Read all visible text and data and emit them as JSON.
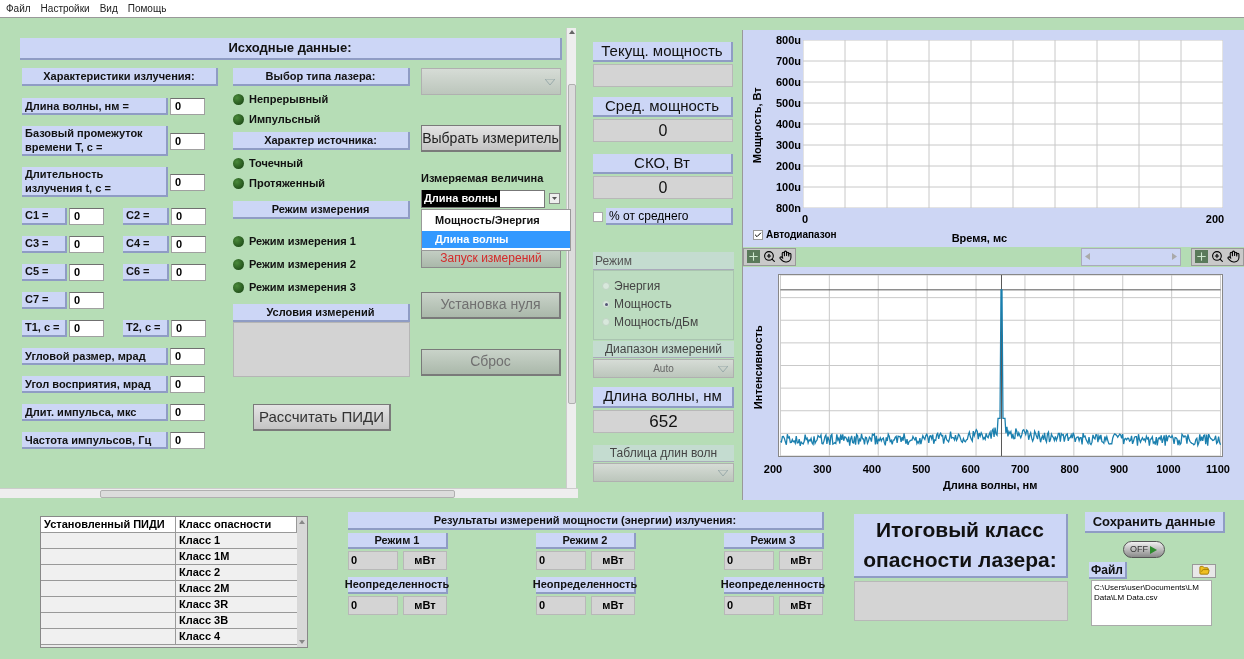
{
  "menu": [
    "Файл",
    "Настройки",
    "Вид",
    "Помощь"
  ],
  "input_panel": {
    "title": "Исходные данные:",
    "radiation": {
      "header": "Характеристики излучения:",
      "rows": [
        {
          "kind": "single",
          "fields": [
            {
              "label": "Длина волны, нм =",
              "value": "0"
            }
          ]
        },
        {
          "kind": "single",
          "fields": [
            {
              "label": "Базовый промежуток времени T, с =",
              "value": "0"
            }
          ]
        },
        {
          "kind": "single",
          "fields": [
            {
              "label": "Длительность излучения t, с =",
              "value": "0"
            }
          ]
        },
        {
          "kind": "pair",
          "fields": [
            {
              "label": "C1 =",
              "value": "0"
            },
            {
              "label": "C2 =",
              "value": "0"
            }
          ]
        },
        {
          "kind": "pair",
          "fields": [
            {
              "label": "C3 =",
              "value": "0"
            },
            {
              "label": "C4 =",
              "value": "0"
            }
          ]
        },
        {
          "kind": "pair",
          "fields": [
            {
              "label": "C5 =",
              "value": "0"
            },
            {
              "label": "C6 =",
              "value": "0"
            }
          ]
        },
        {
          "kind": "pair",
          "fields": [
            {
              "label": "C7 =",
              "value": "0"
            }
          ]
        },
        {
          "kind": "pair",
          "fields": [
            {
              "label": "T1, c =",
              "value": "0"
            },
            {
              "label": "T2, c =",
              "value": "0"
            }
          ]
        },
        {
          "kind": "single",
          "fields": [
            {
              "label": "Угловой размер, мрад",
              "value": "0"
            }
          ]
        },
        {
          "kind": "single",
          "fields": [
            {
              "label": "Угол восприятия, мрад",
              "value": "0"
            }
          ]
        },
        {
          "kind": "single",
          "fields": [
            {
              "label": "Длит. импульса, мкс",
              "value": "0"
            }
          ]
        },
        {
          "kind": "single",
          "fields": [
            {
              "label": "Частота импульсов, Гц",
              "value": "0"
            }
          ]
        }
      ]
    },
    "laser_type": {
      "header": "Выбор типа лазера:",
      "options": [
        {
          "label": "Непрерывный",
          "on": false
        },
        {
          "label": "Импульсный",
          "on": false
        }
      ]
    },
    "source_type": {
      "header": "Характер источника:",
      "options": [
        {
          "label": "Точечный",
          "on": false
        },
        {
          "label": "Протяженный",
          "on": false
        }
      ]
    },
    "measurement_mode": {
      "header": "Режим измерения",
      "options": [
        {
          "label": "Режим измерения 1",
          "on": false
        },
        {
          "label": "Режим измерения 2",
          "on": false
        },
        {
          "label": "Режим измерения 3",
          "on": false
        }
      ]
    },
    "conditions": {
      "header": "Условия измерений"
    },
    "calculate_button": "Рассчитать ПИДИ",
    "meter_dropdown": {
      "disabled": true
    },
    "select_meter_button": "Выбрать измеритель",
    "measured_quantity": {
      "label": "Измеряемая величина",
      "value": "Длина волны",
      "expanded": true,
      "options": [
        {
          "label": "Мощность/Энергия",
          "selected": false
        },
        {
          "label": "Длина волны",
          "selected": true
        }
      ]
    },
    "start_button": {
      "label": "Запуск измерений"
    },
    "zero_button": {
      "label": "Установка нуля",
      "disabled": true
    },
    "reset_button": {
      "label": "Сброс",
      "disabled": true
    }
  },
  "readouts": [
    {
      "label": "Текущ. мощность"
    },
    {
      "label": "Сред. мощность",
      "value": "0"
    },
    {
      "label": "СКО, Вт",
      "value": "0"
    }
  ],
  "percent_of_mean": {
    "label": "% от среднего",
    "checked": false
  },
  "mode": {
    "label": "Режим",
    "disabled": true,
    "options": [
      {
        "label": "Энергия",
        "selected": false
      },
      {
        "label": "Мощность",
        "selected": true
      },
      {
        "label": "Мощность/дБм",
        "selected": false
      }
    ]
  },
  "range": {
    "label": "Диапазон измерений",
    "value": "Auto",
    "disabled": true
  },
  "wavelength": {
    "label": "Длина волны, нм",
    "value": "652"
  },
  "wavelength_table": {
    "label": "Таблица длин волн",
    "disabled": true
  },
  "power_plot": {
    "ylabel": "Мощность, Вт",
    "yticks": [
      "800u",
      "700u",
      "600u",
      "500u",
      "400u",
      "300u",
      "200u",
      "100u",
      "800n"
    ],
    "xticks": [
      "0",
      "200"
    ],
    "xlabel": "Время, мс",
    "autorange": {
      "label": "Автодиапазон",
      "checked": true
    }
  },
  "spectrum_plot": {
    "ylabel": "Интенсивность",
    "xticks": [
      "200",
      "300",
      "400",
      "500",
      "600",
      "700",
      "800",
      "900",
      "1000",
      "1100"
    ],
    "xlabel": "Длина волны, нм"
  },
  "class_table": {
    "columns": [
      "Установленный ПИДИ",
      "Класс опасности"
    ],
    "rows": [
      {
        "class": "Класс 1"
      },
      {
        "class": "Класс 1M"
      },
      {
        "class": "Класс 2"
      },
      {
        "class": "Класс 2M"
      },
      {
        "class": "Класс 3R"
      },
      {
        "class": "Класс 3B"
      },
      {
        "class": "Класс 4"
      }
    ]
  },
  "results": {
    "title": "Результаты измерений мощности (энергии) излучения:",
    "modes": [
      {
        "label": "Режим 1",
        "value": "0",
        "unit": "мВт",
        "uncertainty_label": "Неопределенность",
        "uncertainty_value": "0",
        "uncertainty_unit": "мВт"
      },
      {
        "label": "Режим 2",
        "value": "0",
        "unit": "мВт",
        "uncertainty_label": "Неопределенность",
        "uncertainty_value": "0",
        "uncertainty_unit": "мВт"
      },
      {
        "label": "Режим 3",
        "value": "0",
        "unit": "мВт",
        "uncertainty_label": "Неопределенность",
        "uncertainty_value": "0",
        "uncertainty_unit": "мВт"
      }
    ]
  },
  "final_class": {
    "title": "Итоговый класс опасности лазера:"
  },
  "save": {
    "title": "Сохранить данные",
    "toggle": {
      "label": "OFF",
      "on": false
    },
    "file_label": "Файл",
    "path": "C:\\Users\\user\\Documents\\LM Data\\LM Data.csv"
  }
}
